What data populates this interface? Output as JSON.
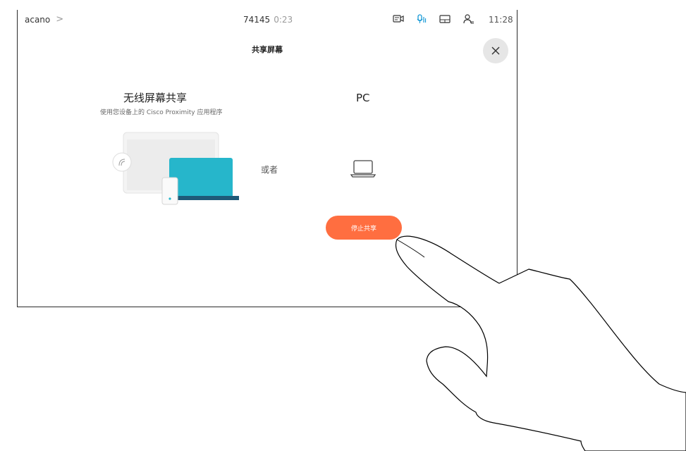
{
  "statusbar": {
    "name": "acano",
    "chevron": ">",
    "call_number": "74145",
    "call_duration": "0:23",
    "time": "11:28",
    "icons": [
      "camera-icon",
      "microphone-icon",
      "layout-icon",
      "participants-icon"
    ],
    "accent": "#1a9bd7"
  },
  "panel": {
    "title": "共享屏幕",
    "wireless": {
      "heading": "无线屏幕共享",
      "subtitle": "使用您设备上的 Cisco Proximity 应用程序"
    },
    "or_label": "或者",
    "pc": {
      "heading": "PC"
    },
    "stop_button": {
      "label": "停止共享",
      "color": "#ff6e40"
    }
  }
}
